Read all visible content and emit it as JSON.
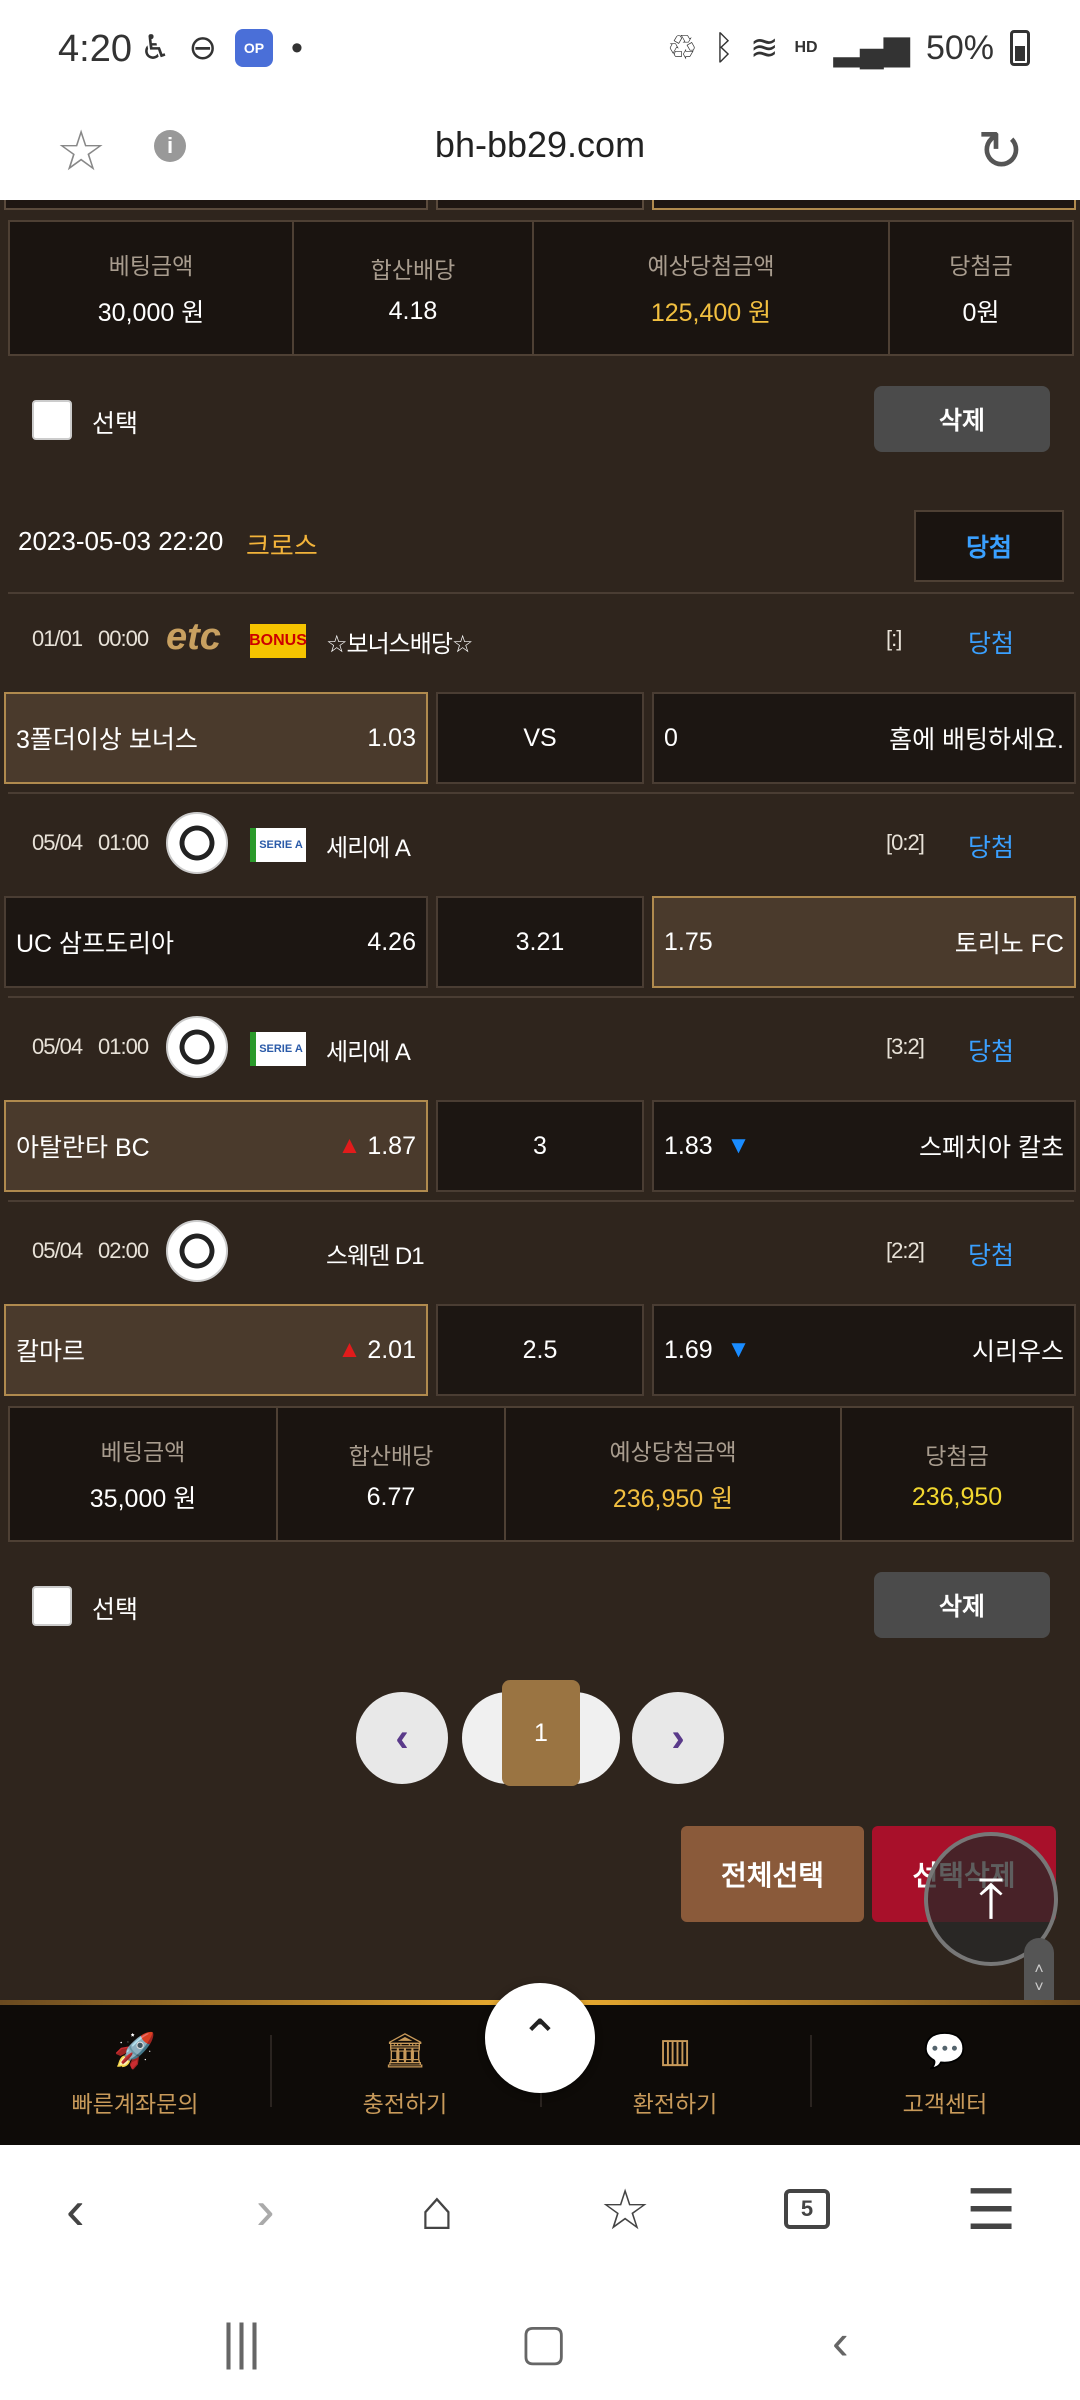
{
  "status": {
    "time": "4:20",
    "battery": "50%",
    "hd": "HD"
  },
  "browser": {
    "url": "bh-bb29.com",
    "tabs_count": "5"
  },
  "bet1": {
    "amount_label": "베팅금액",
    "amount": "30,000 원",
    "odds_label": "합산배당",
    "odds": "4.18",
    "expected_label": "예상당첨금액",
    "expected": "125,400 원",
    "win_label": "당첨금",
    "win": "0원"
  },
  "select_label": "선택",
  "delete_label": "삭제",
  "bet2": {
    "datetime": "2023-05-03 22:20",
    "type": "크로스",
    "result": "당첨",
    "games": [
      {
        "date": "01/01",
        "time": "00:00",
        "sport": "etc",
        "flag": "BONUS",
        "league": "☆보너스배당☆",
        "score": "[:]",
        "result": "당첨",
        "home": "3폴더이상 보너스",
        "home_odds": "1.03",
        "draw": "VS",
        "away_odds": "0",
        "away": "홈에 배팅하세요."
      },
      {
        "date": "05/04",
        "time": "01:00",
        "sport": "soccer",
        "flag": "SERIE A",
        "league": "세리에 A",
        "score": "[0:2]",
        "result": "당첨",
        "home": "UC 삼프도리아",
        "home_odds": "4.26",
        "draw": "3.21",
        "away_odds": "1.75",
        "away": "토리노 FC"
      },
      {
        "date": "05/04",
        "time": "01:00",
        "sport": "soccer",
        "flag": "SERIE A",
        "league": "세리에 A",
        "score": "[3:2]",
        "result": "당첨",
        "home": "아탈란타 BC",
        "home_odds": "1.87",
        "draw": "3",
        "away_odds": "1.83",
        "away": "스페치아 칼초"
      },
      {
        "date": "05/04",
        "time": "02:00",
        "sport": "soccer",
        "flag": "SE",
        "league": "스웨덴 D1",
        "score": "[2:2]",
        "result": "당첨",
        "home": "칼마르",
        "home_odds": "2.01",
        "draw": "2.5",
        "away_odds": "1.69",
        "away": "시리우스"
      }
    ],
    "amount_label": "베팅금액",
    "amount": "35,000 원",
    "odds_label": "합산배당",
    "odds": "6.77",
    "expected_label": "예상당첨금액",
    "expected": "236,950 원",
    "win_label": "당첨금",
    "win": "236,950"
  },
  "pager": {
    "prev": "‹",
    "current": "1",
    "next": "›"
  },
  "actions": {
    "select_all": "전체선택",
    "delete_selected": "선택삭제"
  },
  "bottom_nav": [
    {
      "label": "빠른계좌문의",
      "icon": "rocket-icon"
    },
    {
      "label": "충전하기",
      "icon": "bank-icon"
    },
    {
      "label": "환전하기",
      "icon": "atm-icon"
    },
    {
      "label": "고객센터",
      "icon": "chat-icon"
    }
  ],
  "colors": {
    "background": "#2f251d",
    "accent_gold": "#f2c040",
    "result_blue": "#3aa0ff",
    "delete_red": "#a8102a"
  }
}
